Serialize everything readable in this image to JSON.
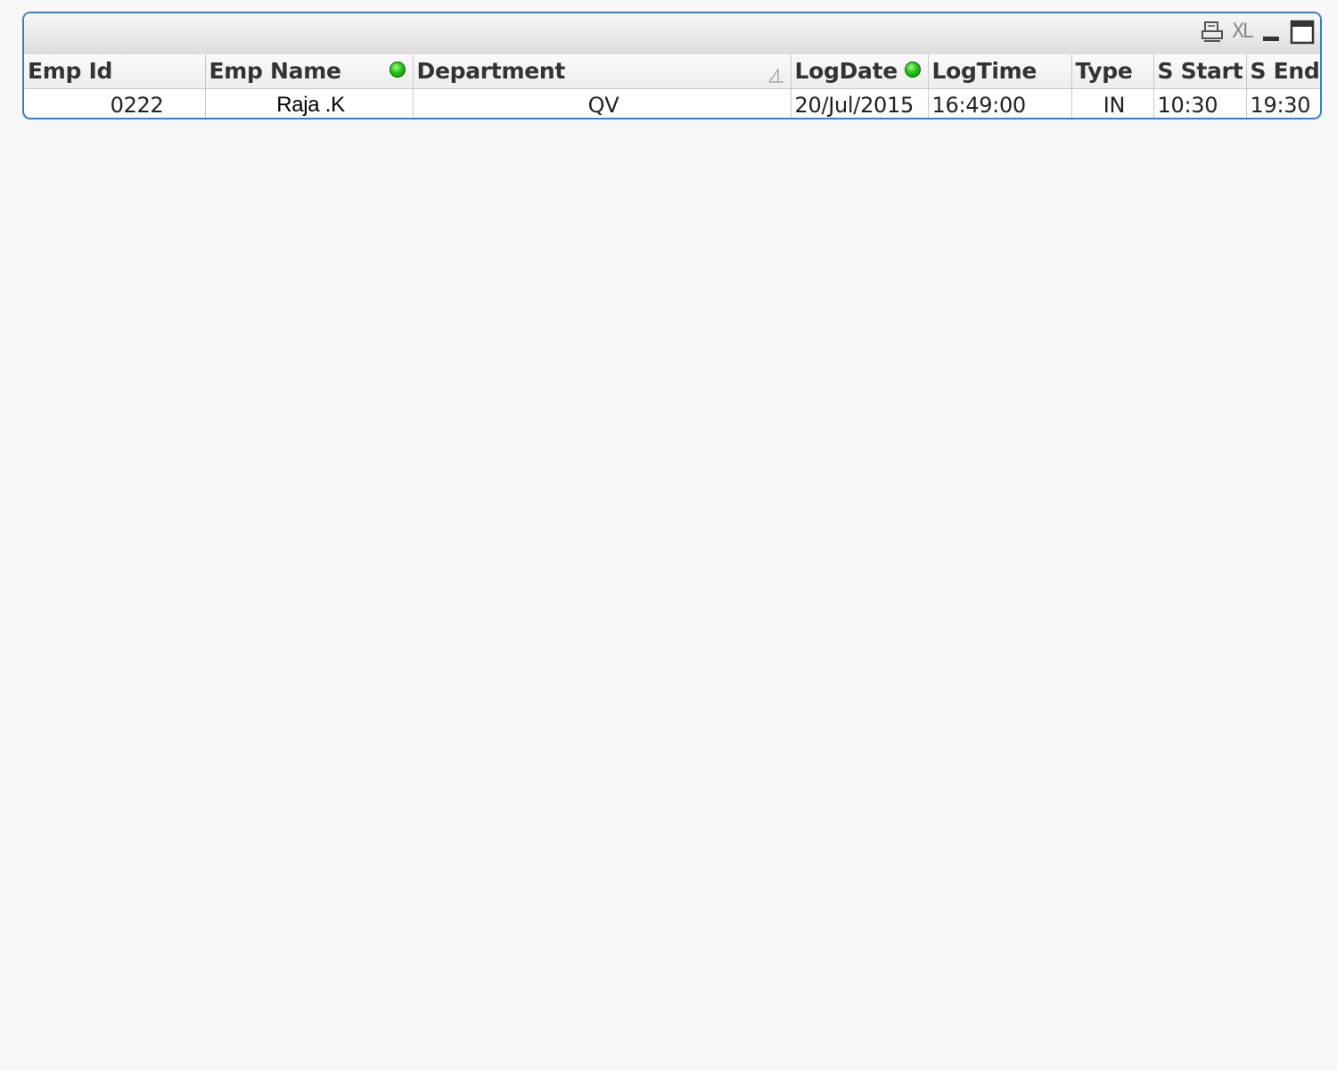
{
  "caption": {
    "icons": [
      "print-icon",
      "export-excel-icon",
      "minimize-icon",
      "maximize-icon"
    ],
    "xl_label": "XL"
  },
  "table": {
    "headers": {
      "emp_id": "Emp Id",
      "emp_name": "Emp Name",
      "department": "Department",
      "log_date": "LogDate",
      "log_time": "LogTime",
      "type": "Type",
      "s_start": "S Start",
      "s_end": "S End"
    },
    "header_indicators": {
      "emp_name": "green-selection-dot",
      "department": "sort-ascending-arrow",
      "log_date": "green-selection-dot"
    },
    "rows": [
      {
        "emp_id": "0222",
        "emp_name": "Raja .K",
        "department": "QV",
        "log_date": "20/Jul/2015",
        "log_time": "16:49:00",
        "type": "IN",
        "s_start": "10:30",
        "s_end": "19:30"
      }
    ]
  },
  "colors": {
    "border_accent": "#3a7dc9",
    "selection_dot": "#27c21a",
    "background": "#f7f7f7"
  }
}
